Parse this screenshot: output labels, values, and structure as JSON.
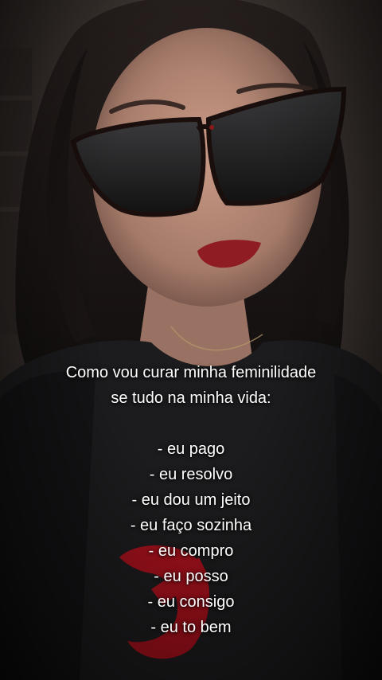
{
  "caption": {
    "intro": [
      "Como vou curar minha feminilidade",
      "se tudo na minha vida:"
    ],
    "items": [
      "- eu pago",
      "- eu resolvo",
      "- eu dou um jeito",
      "- eu faço sozinha",
      "- eu compro",
      "- eu posso",
      "- eu consigo",
      "- eu to bem"
    ]
  },
  "colors": {
    "text": "#ffffff",
    "background": "#2a2523",
    "skin": "#b98a78",
    "hair": "#1a1514",
    "shirt": "#1c1b1d",
    "logo_red": "#b0101c",
    "lips": "#8e1c22"
  }
}
